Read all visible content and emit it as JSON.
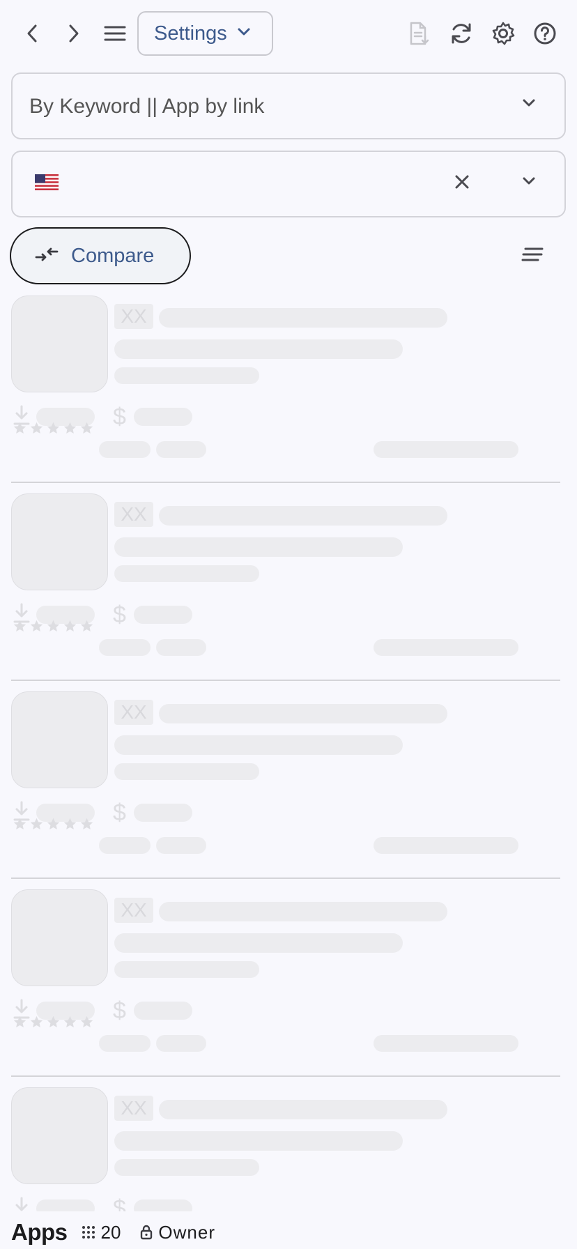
{
  "toolbar": {
    "settings_label": "Settings",
    "icons": [
      "chevron-left-icon",
      "chevron-right-icon",
      "hamburger-menu-icon",
      "export-document-icon",
      "refresh-icon",
      "gear-icon",
      "help-icon"
    ]
  },
  "search": {
    "placeholder": "By Keyword || App by link"
  },
  "country": {
    "selected_flag": "us-flag-icon"
  },
  "actions": {
    "compare_label": "Compare"
  },
  "list": {
    "skeleton_cards": [
      {
        "developer_placeholder": "XX"
      },
      {
        "developer_placeholder": "XX"
      },
      {
        "developer_placeholder": "XX"
      },
      {
        "developer_placeholder": "XX"
      },
      {
        "developer_placeholder": "XX"
      }
    ]
  },
  "footer": {
    "title": "Apps",
    "count": "20",
    "role": "Owner"
  },
  "colors": {
    "accent": "#3d5a8c",
    "background": "#f8f8fd",
    "skeleton": "#ececef",
    "divider": "#d4d4d8"
  }
}
